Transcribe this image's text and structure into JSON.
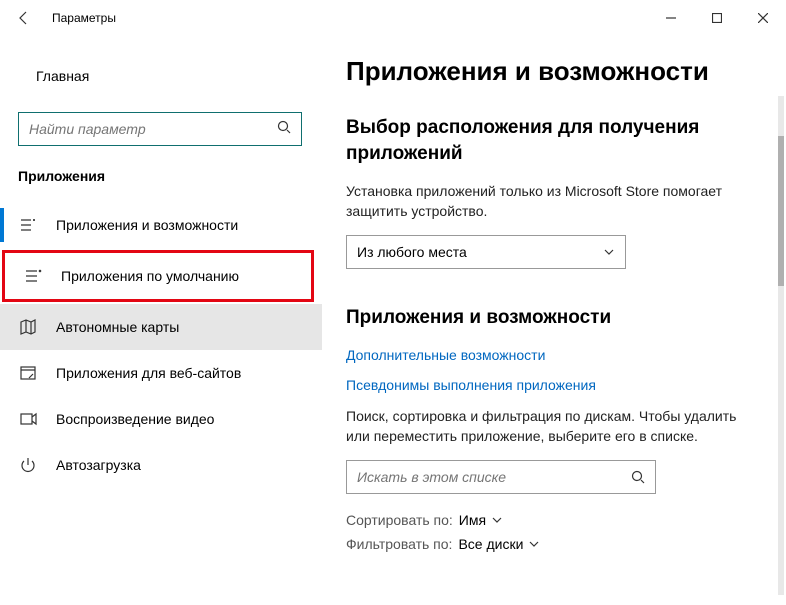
{
  "window": {
    "title": "Параметры"
  },
  "sidebar": {
    "home": "Главная",
    "search_placeholder": "Найти параметр",
    "section": "Приложения",
    "items": [
      {
        "label": "Приложения и возможности"
      },
      {
        "label": "Приложения по умолчанию"
      },
      {
        "label": "Автономные карты"
      },
      {
        "label": "Приложения для веб-сайтов"
      },
      {
        "label": "Воспроизведение видео"
      },
      {
        "label": "Автозагрузка"
      }
    ]
  },
  "content": {
    "title": "Приложения и возможности",
    "source_heading": "Выбор расположения для получения приложений",
    "source_desc": "Установка приложений только из Microsoft Store помогает защитить устройство.",
    "source_value": "Из любого места",
    "apps_heading": "Приложения и возможности",
    "link_optional": "Дополнительные возможности",
    "link_aliases": "Псевдонимы выполнения приложения",
    "list_desc": "Поиск, сортировка и фильтрация по дискам. Чтобы удалить или переместить приложение, выберите его в списке.",
    "list_search_placeholder": "Искать в этом списке",
    "sort_label": "Сортировать по:",
    "sort_value": "Имя",
    "filter_label": "Фильтровать по:",
    "filter_value": "Все диски"
  }
}
